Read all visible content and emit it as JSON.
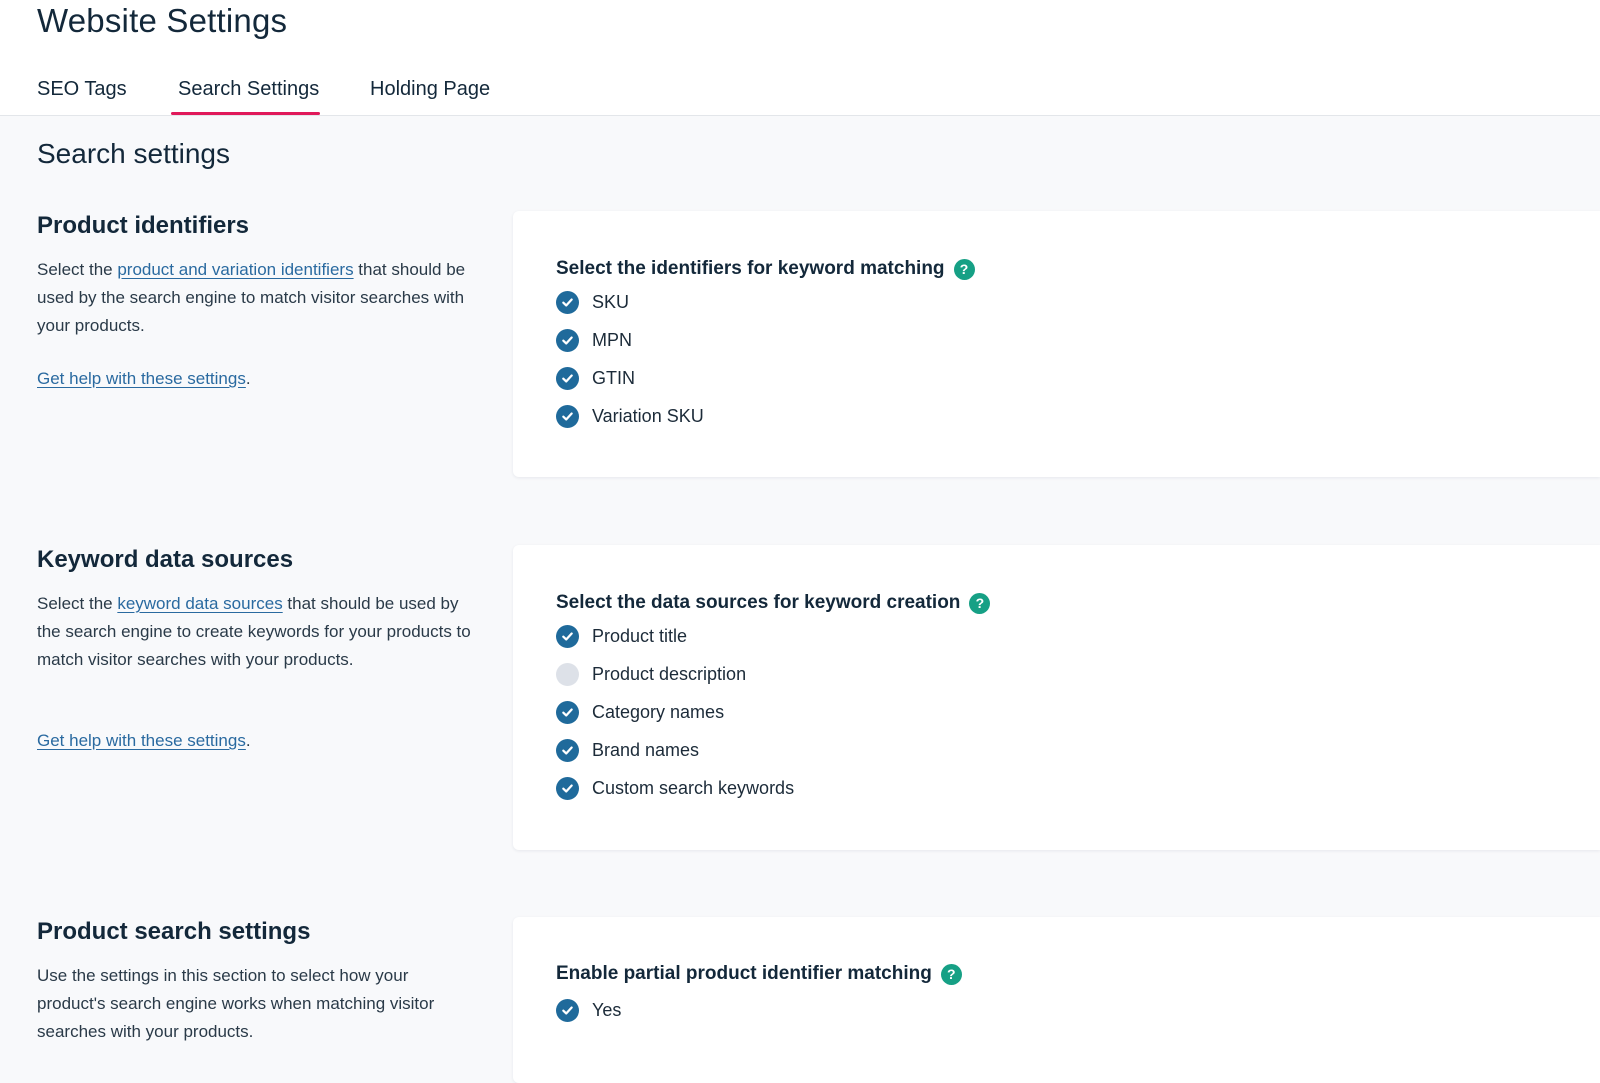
{
  "header": {
    "title": "Website Settings",
    "tabs": [
      {
        "label": "SEO Tags",
        "active": false
      },
      {
        "label": "Search Settings",
        "active": true
      },
      {
        "label": "Holding Page",
        "active": false
      }
    ]
  },
  "main": {
    "heading": "Search settings",
    "groups": [
      {
        "title": "Product identifiers",
        "desc_before": "Select the ",
        "desc_link": "product and variation identifiers",
        "desc_after": " that should be used by the search engine to match visitor searches with your products.",
        "help_link": "Get help with these settings",
        "card_label": "Select the identifiers for keyword matching",
        "options": [
          {
            "label": "SKU",
            "checked": true
          },
          {
            "label": "MPN",
            "checked": true
          },
          {
            "label": "GTIN",
            "checked": true
          },
          {
            "label": "Variation SKU",
            "checked": true
          }
        ]
      },
      {
        "title": "Keyword data sources",
        "desc_before": "Select the ",
        "desc_link": "keyword data sources",
        "desc_after": " that should be used by the search engine to create keywords for your products to match visitor searches with your products.",
        "help_link": "Get help with these settings",
        "card_label": "Select the data sources for keyword creation",
        "options": [
          {
            "label": "Product title",
            "checked": true
          },
          {
            "label": "Product description",
            "checked": false
          },
          {
            "label": "Category names",
            "checked": true
          },
          {
            "label": "Brand names",
            "checked": true
          },
          {
            "label": "Custom search keywords",
            "checked": true
          }
        ]
      },
      {
        "title": "Product search settings",
        "desc": "Use the settings in this section to select how your product's search engine works when matching visitor searches with your products.",
        "card_label": "Enable partial product identifier matching",
        "options": [
          {
            "label": "Yes",
            "checked": true
          }
        ]
      }
    ],
    "help_suffix": ".",
    "help_icon_glyph": "?"
  },
  "colors": {
    "accent_tab": "#e0195a",
    "checked": "#1f6a9b",
    "unchecked": "#dde1e8",
    "help_icon": "#16a085",
    "link": "#2a6aa0"
  }
}
